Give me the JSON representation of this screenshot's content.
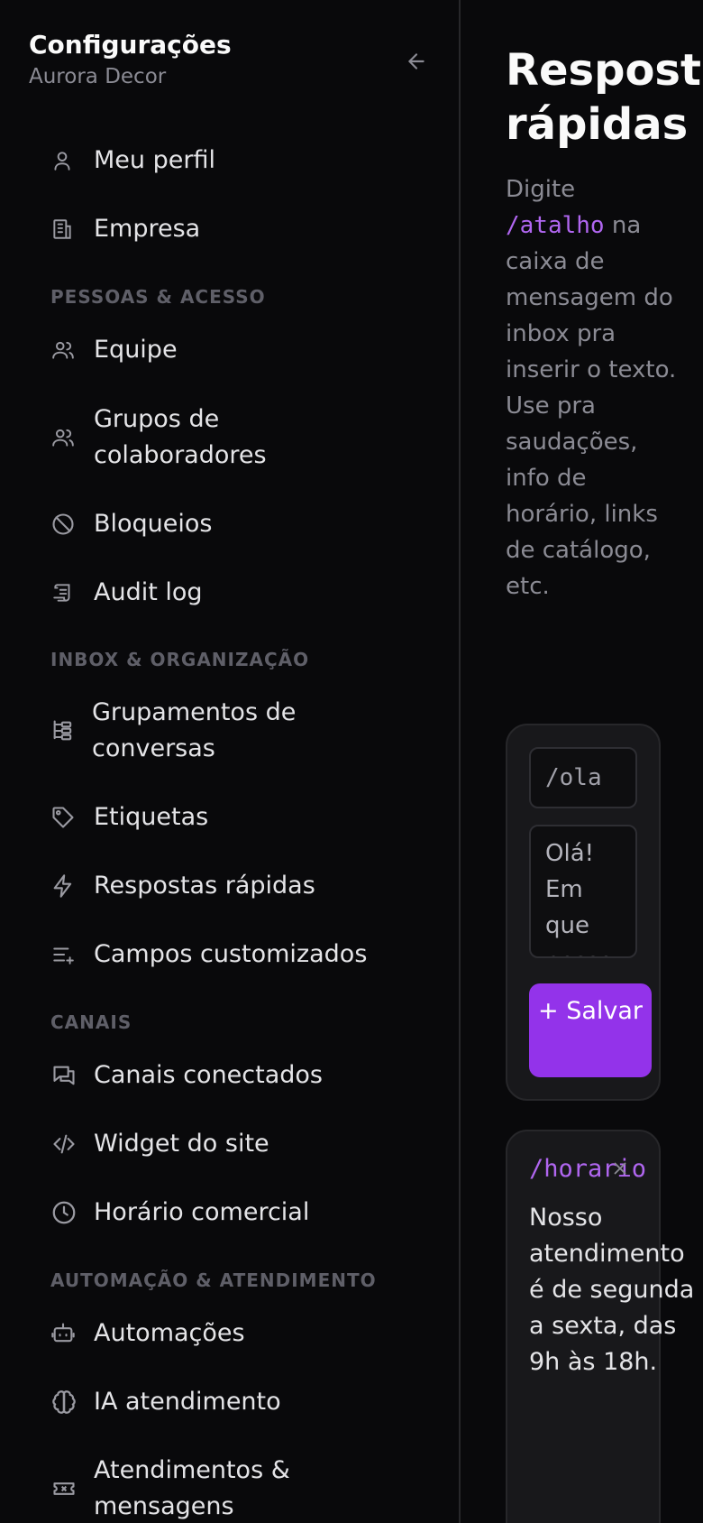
{
  "sidebar": {
    "title": "Configurações",
    "subtitle": "Aurora Decor",
    "items": {
      "perfil": "Meu perfil",
      "empresa": "Empresa",
      "equipe": "Equipe",
      "grupos": "Grupos de colaboradores",
      "bloqueios": "Bloqueios",
      "audit": "Audit log",
      "grupamentos": "Grupamentos de conversas",
      "etiquetas": "Etiquetas",
      "respostas": "Respostas rápidas",
      "campos": "Campos customizados",
      "canais": "Canais conectados",
      "widget": "Widget do site",
      "horario": "Horário comercial",
      "automacoes": "Automações",
      "ia": "IA atendimento",
      "atendimentos": "Atendimentos & mensagens"
    },
    "sections": {
      "pessoas": "PESSOAS & ACESSO",
      "inbox": "INBOX & ORGANIZAÇÃO",
      "canais": "CANAIS",
      "automacao": "AUTOMAÇÃO & ATENDIMENTO"
    }
  },
  "main": {
    "title": "Respostas rápidas",
    "description_before": "Digite",
    "description_code": "/atalho",
    "description_after": "na caixa de mensagem do inbox pra inserir o texto. Use pra saudações, info de horário, links de catálogo, etc.",
    "form": {
      "shortcut_value": "/ola",
      "text_value": "Olá! Em que posso ajudar?",
      "save_label": "+ Salvar"
    },
    "replies": [
      {
        "shortcut": "/horario",
        "text": "Nosso atendimento é de segunda a sexta, das 9h às 18h."
      }
    ]
  }
}
